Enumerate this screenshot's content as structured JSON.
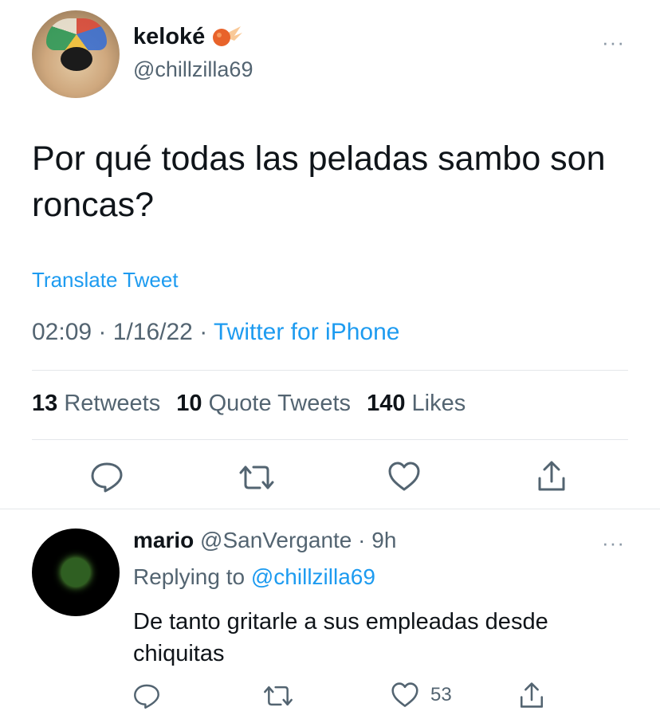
{
  "tweet": {
    "display_name": "keloké",
    "handle": "@chillzilla69",
    "text": "Por qué todas las peladas sambo son roncas?",
    "translate_label": "Translate Tweet",
    "time": "02:09",
    "date": "1/16/22",
    "source": "Twitter for iPhone",
    "more_label": "···",
    "stats": {
      "retweets_count": "13",
      "retweets_label": "Retweets",
      "quotes_count": "10",
      "quotes_label": "Quote Tweets",
      "likes_count": "140",
      "likes_label": "Likes"
    },
    "actions": [
      "reply-icon",
      "retweet-icon",
      "like-icon",
      "share-icon"
    ]
  },
  "reply": {
    "display_name": "mario",
    "handle": "@SanVergante",
    "age": "9h",
    "replying_prefix": "Replying to",
    "replying_to": "@chillzilla69",
    "text": "De tanto gritarle a sus empleadas desde chiquitas",
    "more_label": "···",
    "like_count": "53",
    "actions": [
      "reply-icon",
      "retweet-icon",
      "like-icon",
      "share-icon"
    ]
  },
  "colors": {
    "accent": "#1d9bf0",
    "muted": "#536471",
    "divider": "#e4e7ea",
    "text": "#0f1419"
  }
}
